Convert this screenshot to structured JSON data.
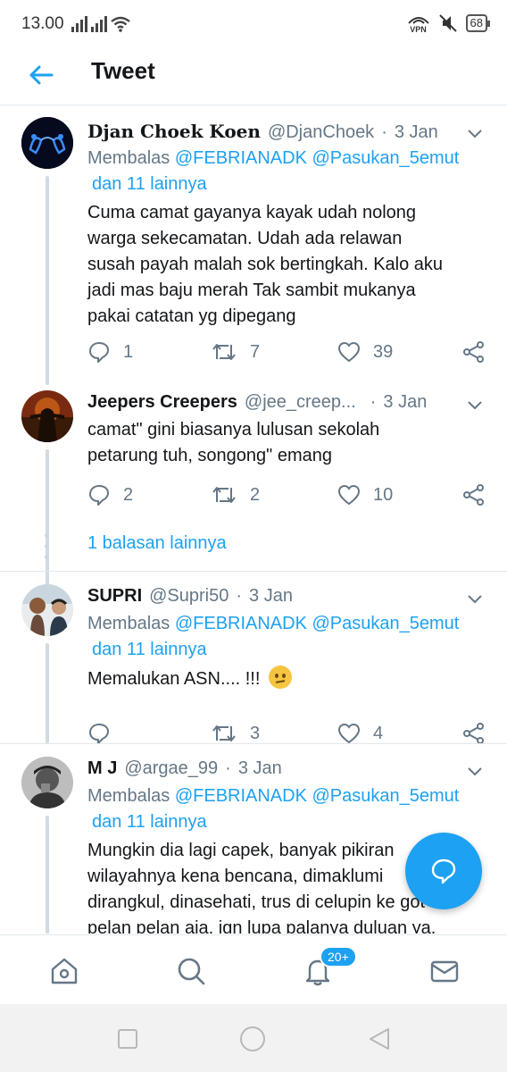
{
  "status_bar": {
    "time": "13.00",
    "vpn": "VPN",
    "battery": "68"
  },
  "header": {
    "title": "Tweet"
  },
  "colors": {
    "accent": "#1da1f2",
    "muted": "#657786",
    "text": "#14171a"
  },
  "tweets": [
    {
      "name": "Djan Choek Koen",
      "handle": "@DjanChoek",
      "sep": "·",
      "date": "3 Jan",
      "reply_prefix": "Membalas",
      "mention_1": "@FEBRIANADK",
      "mention_2": "@Pasukan_5emut",
      "mention_more": "dan 11 lainnya",
      "lines": [
        "Cuma camat gayanya kayak udah nolong",
        "warga sekecamatan.  Udah ada relawan",
        "susah payah malah sok bertingkah.  Kalo aku",
        "jadi mas baju merah Tak sambit mukanya",
        "pakai catatan yg dipegang"
      ],
      "replies": "1",
      "retweets": "7",
      "likes": "39"
    },
    {
      "name": "Jeepers Creepers",
      "handle": "@jee_creep...",
      "sep": "·",
      "date": "3 Jan",
      "lines": [
        "camat\" gini biasanya lulusan sekolah",
        "petarung tuh, songong\" emang"
      ],
      "replies": "2",
      "retweets": "2",
      "likes": "10",
      "more_replies": "1 balasan lainnya"
    },
    {
      "name": "SUPRI",
      "handle": "@Supri50",
      "sep": "·",
      "date": "3 Jan",
      "reply_prefix": "Membalas",
      "mention_1": "@FEBRIANADK",
      "mention_2": "@Pasukan_5emut",
      "mention_more": "dan 11 lainnya",
      "text": "Memalukan ASN.... !!!",
      "emoji": "confused-face",
      "replies": "",
      "retweets": "3",
      "likes": "4"
    },
    {
      "name": "M J",
      "handle": "@argae_99",
      "sep": "·",
      "date": "3 Jan",
      "reply_prefix": "Membalas",
      "mention_1": "@FEBRIANADK",
      "mention_2": "@Pasukan_5emut",
      "mention_more": "dan 11 lainnya",
      "lines": [
        "Mungkin dia lagi capek, banyak pikiran",
        "wilayahnya kena bencana, dimaklumi",
        "dirangkul, dinasehati, trus di celupin ke got",
        "pelan pelan aja, jgn lupa palanya duluan ya."
      ]
    }
  ],
  "bottom_nav": {
    "notifications_badge": "20+"
  }
}
